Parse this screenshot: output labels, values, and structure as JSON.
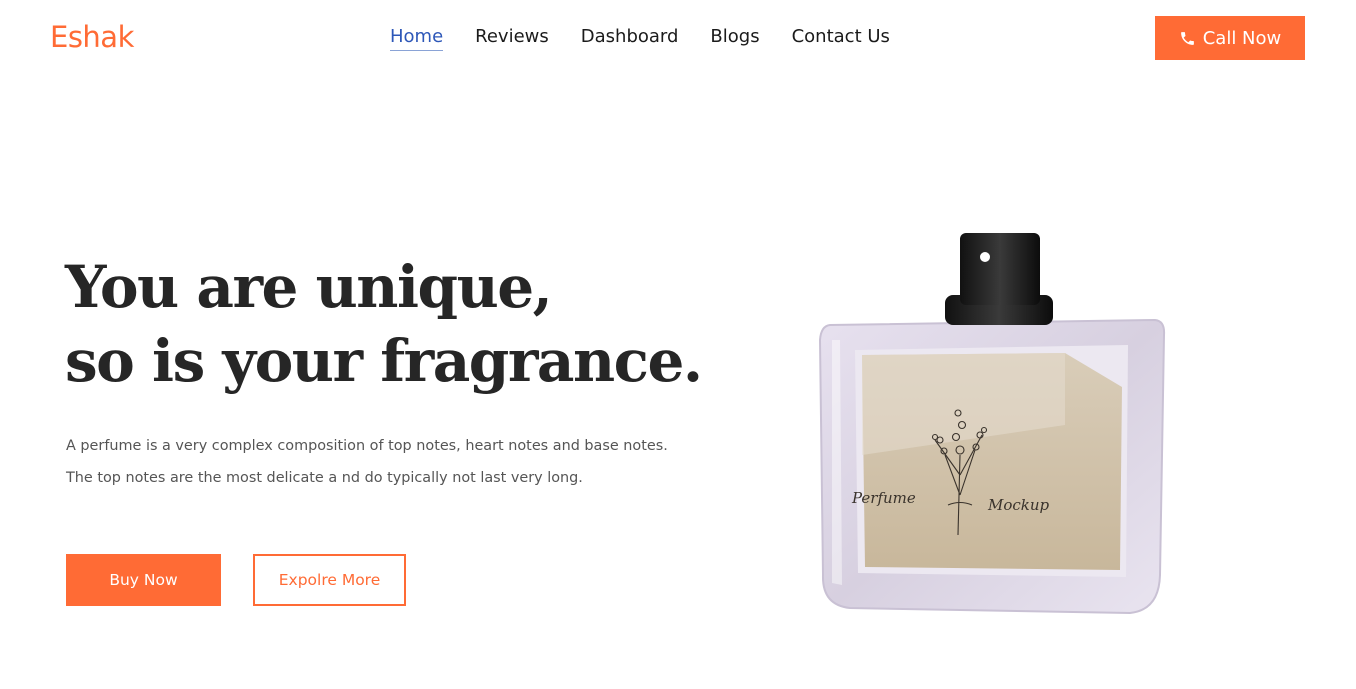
{
  "header": {
    "logo": "Eshak",
    "nav": [
      {
        "label": "Home",
        "active": true
      },
      {
        "label": "Reviews",
        "active": false
      },
      {
        "label": "Dashboard",
        "active": false
      },
      {
        "label": "Blogs",
        "active": false
      },
      {
        "label": "Contact Us",
        "active": false
      }
    ],
    "call_button": {
      "label": "Call Now",
      "icon": "phone-icon"
    }
  },
  "hero": {
    "headline_line1": "You are unique,",
    "headline_line2": "so is your fragrance.",
    "description_line1": "A perfume is a very complex composition of top notes, heart notes and base notes.",
    "description_line2": "The top notes are the most delicate a nd do typically not last very long.",
    "buy_button": "Buy Now",
    "explore_button": "Expolre More",
    "product_label_left": "Perfume",
    "product_label_right": "Mockup"
  },
  "colors": {
    "accent": "#ff6b35",
    "nav_active": "#2d57b8",
    "heading": "#262626",
    "body_text": "#555555"
  }
}
